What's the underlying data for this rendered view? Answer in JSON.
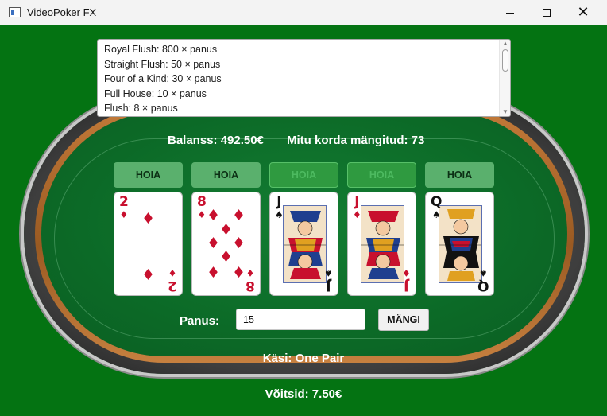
{
  "window": {
    "title": "VideoPoker FX",
    "minimize": "—",
    "maximize": "☐",
    "close": "✕"
  },
  "paytable": {
    "rows": [
      "Royal Flush: 800 × panus",
      "Straight Flush: 50 × panus",
      "Four of a Kind: 30 × panus",
      "Full House: 10 × panus",
      "Flush: 8 × panus"
    ]
  },
  "status": {
    "balance": "Balanss: 492.50€",
    "played": "Mitu korda mängitud: 73"
  },
  "hold_buttons": [
    {
      "label": "HOIA",
      "held": false
    },
    {
      "label": "HOIA",
      "held": false
    },
    {
      "label": "HOIA",
      "held": true
    },
    {
      "label": "HOIA",
      "held": true
    },
    {
      "label": "HOIA",
      "held": false
    }
  ],
  "cards": [
    {
      "rank": "2",
      "suit": "♦",
      "color": "#c8102e"
    },
    {
      "rank": "8",
      "suit": "♦",
      "color": "#c8102e"
    },
    {
      "rank": "J",
      "suit": "♠",
      "color": "#111111"
    },
    {
      "rank": "J",
      "suit": "♦",
      "color": "#c8102e"
    },
    {
      "rank": "Q",
      "suit": "♠",
      "color": "#111111"
    }
  ],
  "bet": {
    "label": "Panus:",
    "value": "15"
  },
  "play_button": "MÄNGI",
  "hand": "Käsi: One Pair",
  "winnings": "Võitsid: 7.50€",
  "colors": {
    "felt": "#047312",
    "held_button": "#2f9a40",
    "button": "#5ab06d"
  }
}
